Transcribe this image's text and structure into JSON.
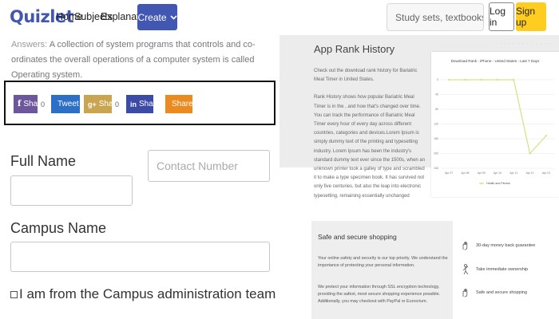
{
  "header": {
    "logo": "Quizlet",
    "nav": [
      "Home",
      "Subjects",
      "Explanations"
    ],
    "create_label": "Create",
    "search_placeholder": "Study sets, textbooks, ...",
    "login_label": "Log in",
    "signup_label": "Sign up"
  },
  "answer": {
    "label": "Answers:",
    "text": "A collection of system programs that controls and co-ordinates the overall operations of a computer system is called Operating system."
  },
  "share": {
    "buttons": [
      {
        "label": "Share",
        "icon": "facebook-icon",
        "color": "#6d569c",
        "count": "0"
      },
      {
        "label": "Tweet",
        "icon": "twitter-icon",
        "color": "#2c6fc4",
        "count": ""
      },
      {
        "label": "Share",
        "icon": "google-plus-icon",
        "color": "#c9a552",
        "count": "0"
      },
      {
        "label": "Share",
        "icon": "linkedin-icon",
        "color": "#3c4ca6",
        "count": ""
      },
      {
        "label": "Share",
        "icon": "stumbleupon-icon",
        "color": "#eb8a1f",
        "count": ""
      }
    ]
  },
  "form": {
    "full_name_label": "Full Name",
    "contact_placeholder": "Contact Number",
    "campus_label": "Campus Name",
    "admin_checkbox_label": "I am from the Campus administration team"
  },
  "rank": {
    "title": "App Rank History",
    "intro": "Check out the download rank history for Bariatric Meal Timer in United States.",
    "body": "Rank History shows how popular Bariatric Meal Timer is in the , and how that's changed over time. You can track the performance of Bariatric Meal Timer every hour of every day across different countries, categories and devices.Lorem Ipsum is simply dummy text of the printing and typesetting industry. Lorem Ipsum has been the industry's standard dummy text ever since the 1500s, when an unknown printer took a galley of type and scrambled it to make a type specimen book. It has survived not only five centuries, but also the leap into electronic typesetting, remaining essentially unchanged"
  },
  "chart_data": {
    "type": "line",
    "title": "Download Rank - iPhone - United States - Last 7 Days",
    "categories": [
      "Apr 07",
      "Apr 08",
      "Apr 09",
      "Apr 10",
      "Apr 11",
      "Apr 12",
      "Apr 13"
    ],
    "y_ticks": [
      "0",
      "40",
      "80",
      "120",
      "160",
      "200",
      "240"
    ],
    "ylim": [
      0,
      240
    ],
    "series": [
      {
        "name": "Health and Fitness",
        "color": "#c8e06a",
        "values": [
          0,
          0,
          0,
          0,
          0,
          200,
          152
        ]
      }
    ]
  },
  "secure": {
    "title": "Safe and secure shopping",
    "p1": "Your online safety and security is our top priority. We understand the importance of protecting your personal information.",
    "p2": "We protect your information through SSL encryption technology, providing the safest, most secure shopping experience possible. Additionally, you may checkout with PayPal or Eurocrium."
  },
  "features": [
    {
      "label": "30-day money back guarantee",
      "icon": "money-back-icon"
    },
    {
      "label": "Take immediate ownership",
      "icon": "ownership-icon"
    },
    {
      "label": "Safe and secure shopping",
      "icon": "secure-shopping-icon"
    }
  ]
}
